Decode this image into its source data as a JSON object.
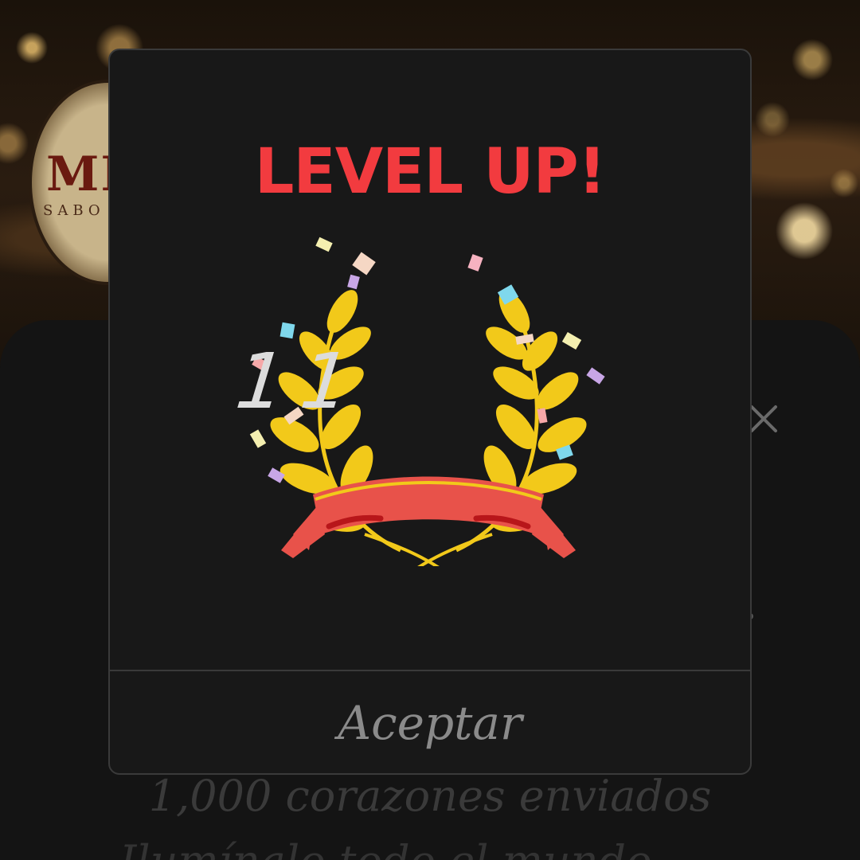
{
  "background": {
    "logo_text": "MI",
    "logo_subtext": "SABO"
  },
  "sheet": {
    "close_icon": "close-icon",
    "hearts_sent_text": "1,000 corazones enviados",
    "next_line_text": "Ilumínalo todo el mundo"
  },
  "dialog": {
    "title": "LEVEL UP!",
    "level": "11",
    "accept_label": "Aceptar",
    "title_color": "#f23b3f",
    "laurel_color": "#f2c91a",
    "ribbon_color": "#e8524a",
    "badge_icon": "laurel-wreath-icon"
  }
}
